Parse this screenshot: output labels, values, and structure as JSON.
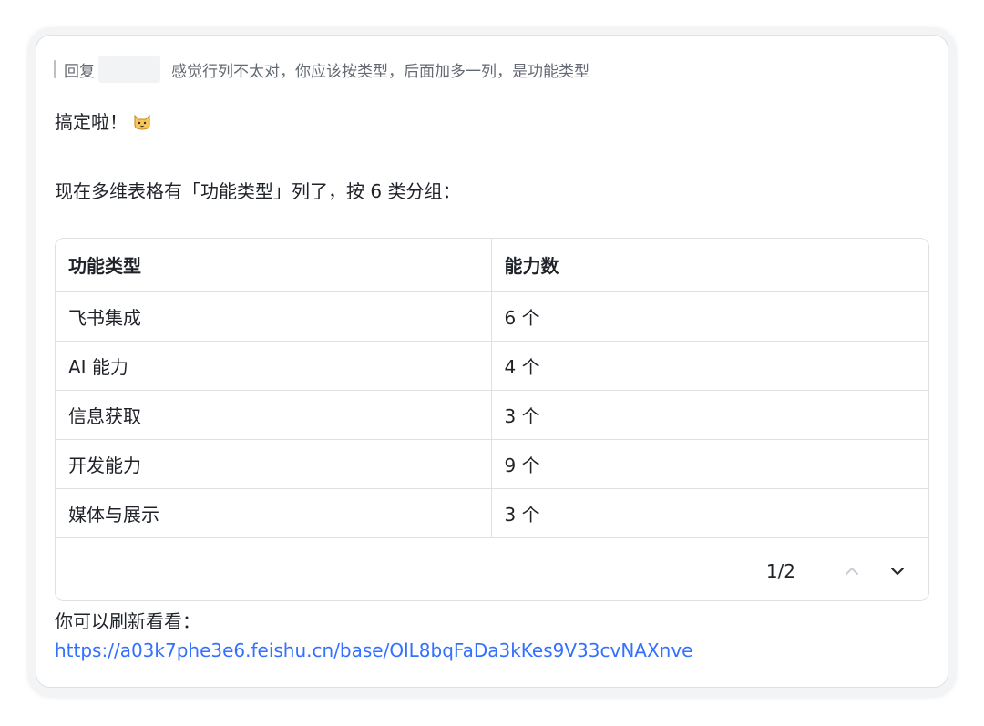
{
  "reply": {
    "prefix": "回复",
    "text": "感觉行列不太对，你应该按类型，后面加多一列，是功能类型"
  },
  "message": {
    "line1": "搞定啦！",
    "line1_emoji": "cat-face-icon",
    "line2": "现在多维表格有「功能类型」列了，按 6 类分组：",
    "line3": "你可以刷新看看：",
    "link": "https://a03k7phe3e6.feishu.cn/base/OlL8bqFaDa3kKes9V33cvNAXnve"
  },
  "table": {
    "headers": [
      "功能类型",
      "能力数"
    ],
    "rows": [
      [
        "飞书集成",
        "6 个"
      ],
      [
        "AI 能力",
        "4 个"
      ],
      [
        "信息获取",
        "3 个"
      ],
      [
        "开发能力",
        "9 个"
      ],
      [
        "媒体与展示",
        "3 个"
      ]
    ],
    "pagination": "1/2"
  },
  "colors": {
    "link": "#3370ff",
    "text": "#1f2329",
    "muted": "#646a73",
    "border": "#dee0e3"
  }
}
